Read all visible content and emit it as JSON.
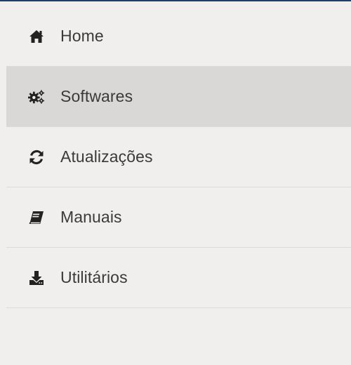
{
  "colors": {
    "accent": "#1f3f66",
    "background": "#f0efed",
    "active_background": "#d9d8d6",
    "divider": "#dcdbd8",
    "text": "#3a3a3a",
    "icon": "#222222"
  },
  "menu": {
    "items": [
      {
        "label": "Home",
        "icon": "home-icon",
        "active": false
      },
      {
        "label": "Softwares",
        "icon": "cogs-icon",
        "active": true
      },
      {
        "label": "Atualizações",
        "icon": "refresh-icon",
        "active": false
      },
      {
        "label": "Manuais",
        "icon": "book-icon",
        "active": false
      },
      {
        "label": "Utilitários",
        "icon": "download-icon",
        "active": false
      }
    ]
  }
}
